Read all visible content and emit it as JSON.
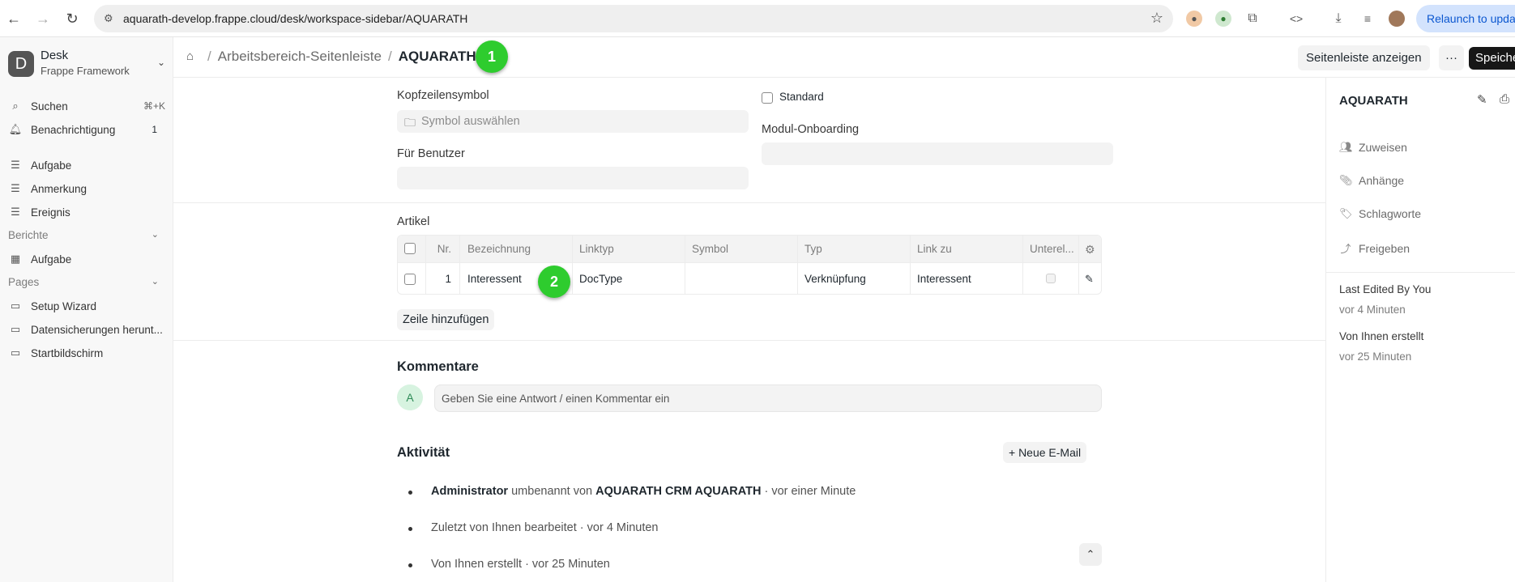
{
  "browser": {
    "url": "aquarath-develop.frappe.cloud/desk/workspace-sidebar/AQUARATH",
    "relaunch_label": "Relaunch to update"
  },
  "sidebar": {
    "workspace_title": "Desk",
    "workspace_subtitle": "Frappe Framework",
    "search_label": "Suchen",
    "search_shortcut": "⌘+K",
    "notifications_label": "Benachrichtigung",
    "notifications_count": "1",
    "items": [
      {
        "label": "Aufgabe"
      },
      {
        "label": "Anmerkung"
      },
      {
        "label": "Ereignis"
      }
    ],
    "reports_section": "Berichte",
    "reports_items": [
      {
        "label": "Aufgabe"
      }
    ],
    "pages_section": "Pages",
    "pages_items": [
      {
        "label": "Setup Wizard"
      },
      {
        "label": "Datensicherungen herunt..."
      },
      {
        "label": "Startbildschirm"
      }
    ]
  },
  "header": {
    "crumb_1": "Arbeitsbereich-Seitenleiste",
    "current": "AQUARATH",
    "badge_1": "1",
    "show_sidebar_button": "Seitenleiste anzeigen",
    "more_button": "···",
    "save_button": "Speichern"
  },
  "form": {
    "header_icon_label": "Kopfzeilensymbol",
    "header_icon_placeholder": "Symbol auswählen",
    "standard_label": "Standard",
    "module_onboarding_label": "Modul-Onboarding",
    "for_user_label": "Für Benutzer",
    "items_label": "Artikel",
    "add_row_button": "Zeile hinzufügen"
  },
  "table": {
    "headers": {
      "nr": "Nr.",
      "label": "Bezeichnung",
      "link_type": "Linktyp",
      "icon": "Symbol",
      "type": "Typ",
      "link_to": "Link zu",
      "child": "Unterel..."
    },
    "rows": [
      {
        "nr": "1",
        "label": "Interessent",
        "link_type": "DocType",
        "icon": "",
        "type": "Verknüpfung",
        "link_to": "Interessent"
      }
    ],
    "badge_2": "2"
  },
  "comments": {
    "title": "Kommentare",
    "avatar_letter": "A",
    "placeholder": "Geben Sie eine Antwort / einen Kommentar ein"
  },
  "activity": {
    "title": "Aktivität",
    "new_email_button": "+ Neue E-Mail",
    "items": [
      {
        "actor": "Administrator",
        "text_1": " umbenannt von ",
        "subject": "AQUARATH CRM AQUARATH",
        "text_2": " · vor einer Minute"
      },
      {
        "text": "Zuletzt von Ihnen bearbeitet · vor 4 Minuten"
      },
      {
        "text": "Von Ihnen erstellt · vor 25 Minuten"
      }
    ]
  },
  "right_sidebar": {
    "title": "AQUARATH",
    "assign": "Zuweisen",
    "attachments": "Anhänge",
    "tags": "Schlagworte",
    "share": "Freigeben",
    "last_edited_label": "Last Edited By You",
    "last_edited_time": "vor 4 Minuten",
    "created_label": "Von Ihnen erstellt",
    "created_time": "vor 25 Minuten"
  }
}
